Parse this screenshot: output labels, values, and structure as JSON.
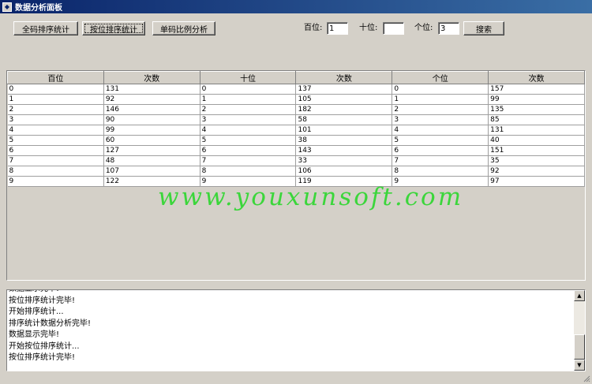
{
  "window": {
    "title": "数据分析面板"
  },
  "toolbar": {
    "btn_full": "全码排序统计",
    "btn_position": "按位排序统计",
    "btn_single": "单码比例分析",
    "label_hundreds": "百位:",
    "label_tens": "十位:",
    "label_ones": "个位:",
    "value_hundreds": "1",
    "value_tens": "",
    "value_ones": "3",
    "btn_search": "搜索"
  },
  "table": {
    "headers": [
      "百位",
      "次数",
      "十位",
      "次数",
      "个位",
      "次数"
    ],
    "rows": [
      [
        "0",
        "131",
        "0",
        "137",
        "0",
        "157"
      ],
      [
        "1",
        "92",
        "1",
        "105",
        "1",
        "99"
      ],
      [
        "2",
        "146",
        "2",
        "182",
        "2",
        "135"
      ],
      [
        "3",
        "90",
        "3",
        "58",
        "3",
        "85"
      ],
      [
        "4",
        "99",
        "4",
        "101",
        "4",
        "131"
      ],
      [
        "5",
        "60",
        "5",
        "38",
        "5",
        "40"
      ],
      [
        "6",
        "127",
        "6",
        "143",
        "6",
        "151"
      ],
      [
        "7",
        "48",
        "7",
        "33",
        "7",
        "35"
      ],
      [
        "8",
        "107",
        "8",
        "106",
        "8",
        "92"
      ],
      [
        "9",
        "122",
        "9",
        "119",
        "9",
        "97"
      ]
    ]
  },
  "watermark": "www.youxunsoft.com",
  "log": {
    "lines": [
      "数据显示完毕!",
      "按位排序统计完毕!",
      "开始排序统计...",
      "排序统计数据分析完毕!",
      "数据显示完毕!",
      "开始按位排序统计...",
      "按位排序统计完毕!"
    ]
  }
}
